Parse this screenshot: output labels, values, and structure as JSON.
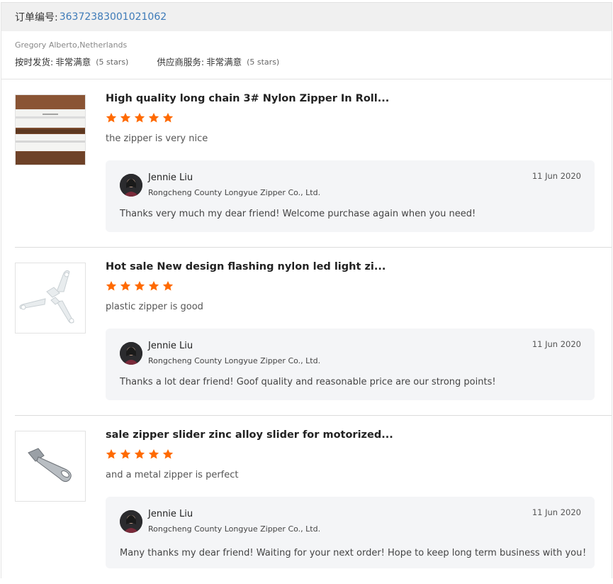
{
  "order": {
    "label": "订单编号:",
    "number": "36372383001021062"
  },
  "buyer": {
    "name": "Gregory Alberto,Netherlands",
    "ratings": [
      {
        "label": "按时发货:",
        "value": "非常满意",
        "count": "(5 stars)"
      },
      {
        "label": "供应商服务:",
        "value": "非常满意",
        "count": "(5 stars)"
      }
    ]
  },
  "colors": {
    "accent_link": "#3d7ab8",
    "star": "#ff6a00",
    "reply_bg": "#f4f5f7"
  },
  "reviews": [
    {
      "thumb_icon": "zipper-roll-image",
      "title": "High quality long chain 3# Nylon Zipper In Roll...",
      "stars": 5,
      "text": "the zipper is very nice",
      "reply": {
        "name": "Jennie Liu",
        "company": "Rongcheng County Longyue Zipper Co., Ltd.",
        "date": "11 Jun 2020",
        "message": "Thanks very much my dear friend! Welcome purchase again when you need!"
      }
    },
    {
      "thumb_icon": "zipper-sliders-image",
      "title": "Hot sale New design flashing nylon led light zi...",
      "stars": 5,
      "text": "plastic zipper is good",
      "reply": {
        "name": "Jennie Liu",
        "company": "Rongcheng County Longyue Zipper Co., Ltd.",
        "date": "11 Jun 2020",
        "message": "Thanks a lot dear friend! Goof quality and reasonable price are our strong points!"
      }
    },
    {
      "thumb_icon": "metal-slider-image",
      "title": "sale zipper slider zinc alloy slider for motorized...",
      "stars": 5,
      "text": "and a metal zipper is perfect",
      "reply": {
        "name": "Jennie Liu",
        "company": "Rongcheng County Longyue Zipper Co., Ltd.",
        "date": "11 Jun 2020",
        "message": "Many thanks my dear friend! Waiting for your next order! Hope to keep long term business with you！"
      }
    }
  ]
}
